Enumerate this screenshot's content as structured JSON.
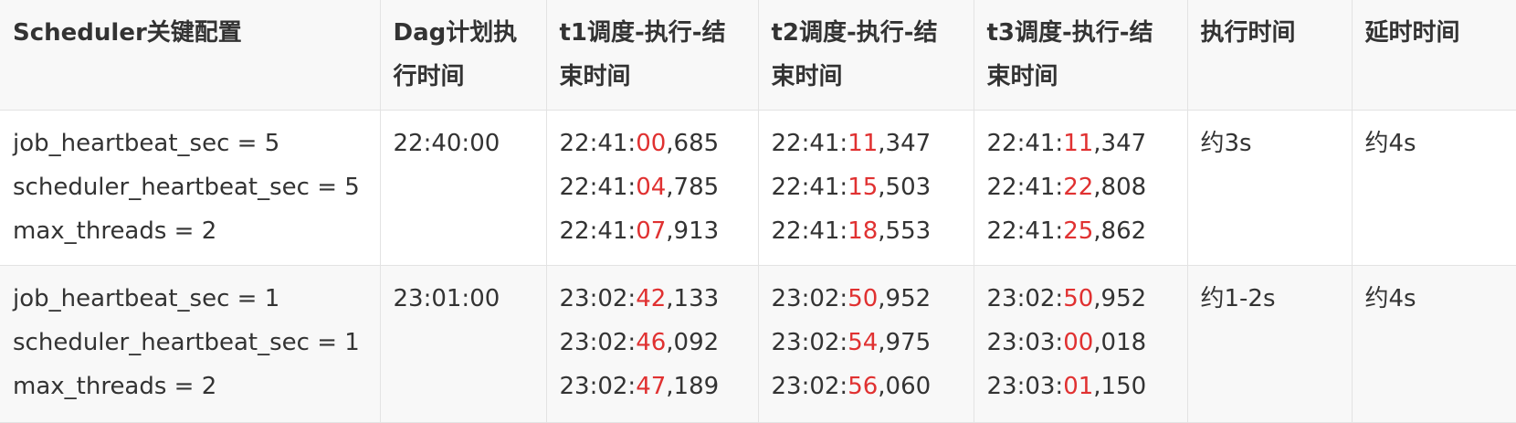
{
  "table": {
    "headers": [
      "Scheduler关键配置",
      "Dag计划执行时间",
      "t1调度-执行-结束时间",
      "t2调度-执行-结束时间",
      "t3调度-执行-结束时间",
      "执行时间",
      "延时时间"
    ],
    "rows": [
      {
        "config": "job_heartbeat_sec = 5 scheduler_heartbeat_sec = 5 max_threads = 2",
        "dag_time": "22:40:00",
        "t1": [
          {
            "prefix": "22:41:",
            "sec": "00",
            "ms": ",685"
          },
          {
            "prefix": "22:41:",
            "sec": "04",
            "ms": ",785"
          },
          {
            "prefix": "22:41:",
            "sec": "07",
            "ms": ",913"
          }
        ],
        "t2": [
          {
            "prefix": "22:41:",
            "sec": "11",
            "ms": ",347"
          },
          {
            "prefix": "22:41:",
            "sec": "15",
            "ms": ",503"
          },
          {
            "prefix": "22:41:",
            "sec": "18",
            "ms": ",553"
          }
        ],
        "t3": [
          {
            "prefix": "22:41:",
            "sec": "11",
            "ms": ",347"
          },
          {
            "prefix": "22:41:",
            "sec": "22",
            "ms": ",808"
          },
          {
            "prefix": "22:41:",
            "sec": "25",
            "ms": ",862"
          }
        ],
        "exec_time": "约3s",
        "delay_time": "约4s"
      },
      {
        "config": "job_heartbeat_sec = 1 scheduler_heartbeat_sec = 1 max_threads = 2",
        "dag_time": "23:01:00",
        "t1": [
          {
            "prefix": "23:02:",
            "sec": "42",
            "ms": ",133"
          },
          {
            "prefix": "23:02:",
            "sec": "46",
            "ms": ",092"
          },
          {
            "prefix": "23:02:",
            "sec": "47",
            "ms": ",189"
          }
        ],
        "t2": [
          {
            "prefix": "23:02:",
            "sec": "50",
            "ms": ",952"
          },
          {
            "prefix": "23:02:",
            "sec": "54",
            "ms": ",975"
          },
          {
            "prefix": "23:02:",
            "sec": "56",
            "ms": ",060"
          }
        ],
        "t3": [
          {
            "prefix": "23:02:",
            "sec": "50",
            "ms": ",952"
          },
          {
            "prefix": "23:03:",
            "sec": "00",
            "ms": ",018"
          },
          {
            "prefix": "23:03:",
            "sec": "01",
            "ms": ",150"
          }
        ],
        "exec_time": "约1-2s",
        "delay_time": "约4s"
      }
    ]
  },
  "colors": {
    "seconds_highlight": "#e03131",
    "text": "#333333",
    "header_bg": "#f8f8f8",
    "border": "#e3e3e3"
  }
}
